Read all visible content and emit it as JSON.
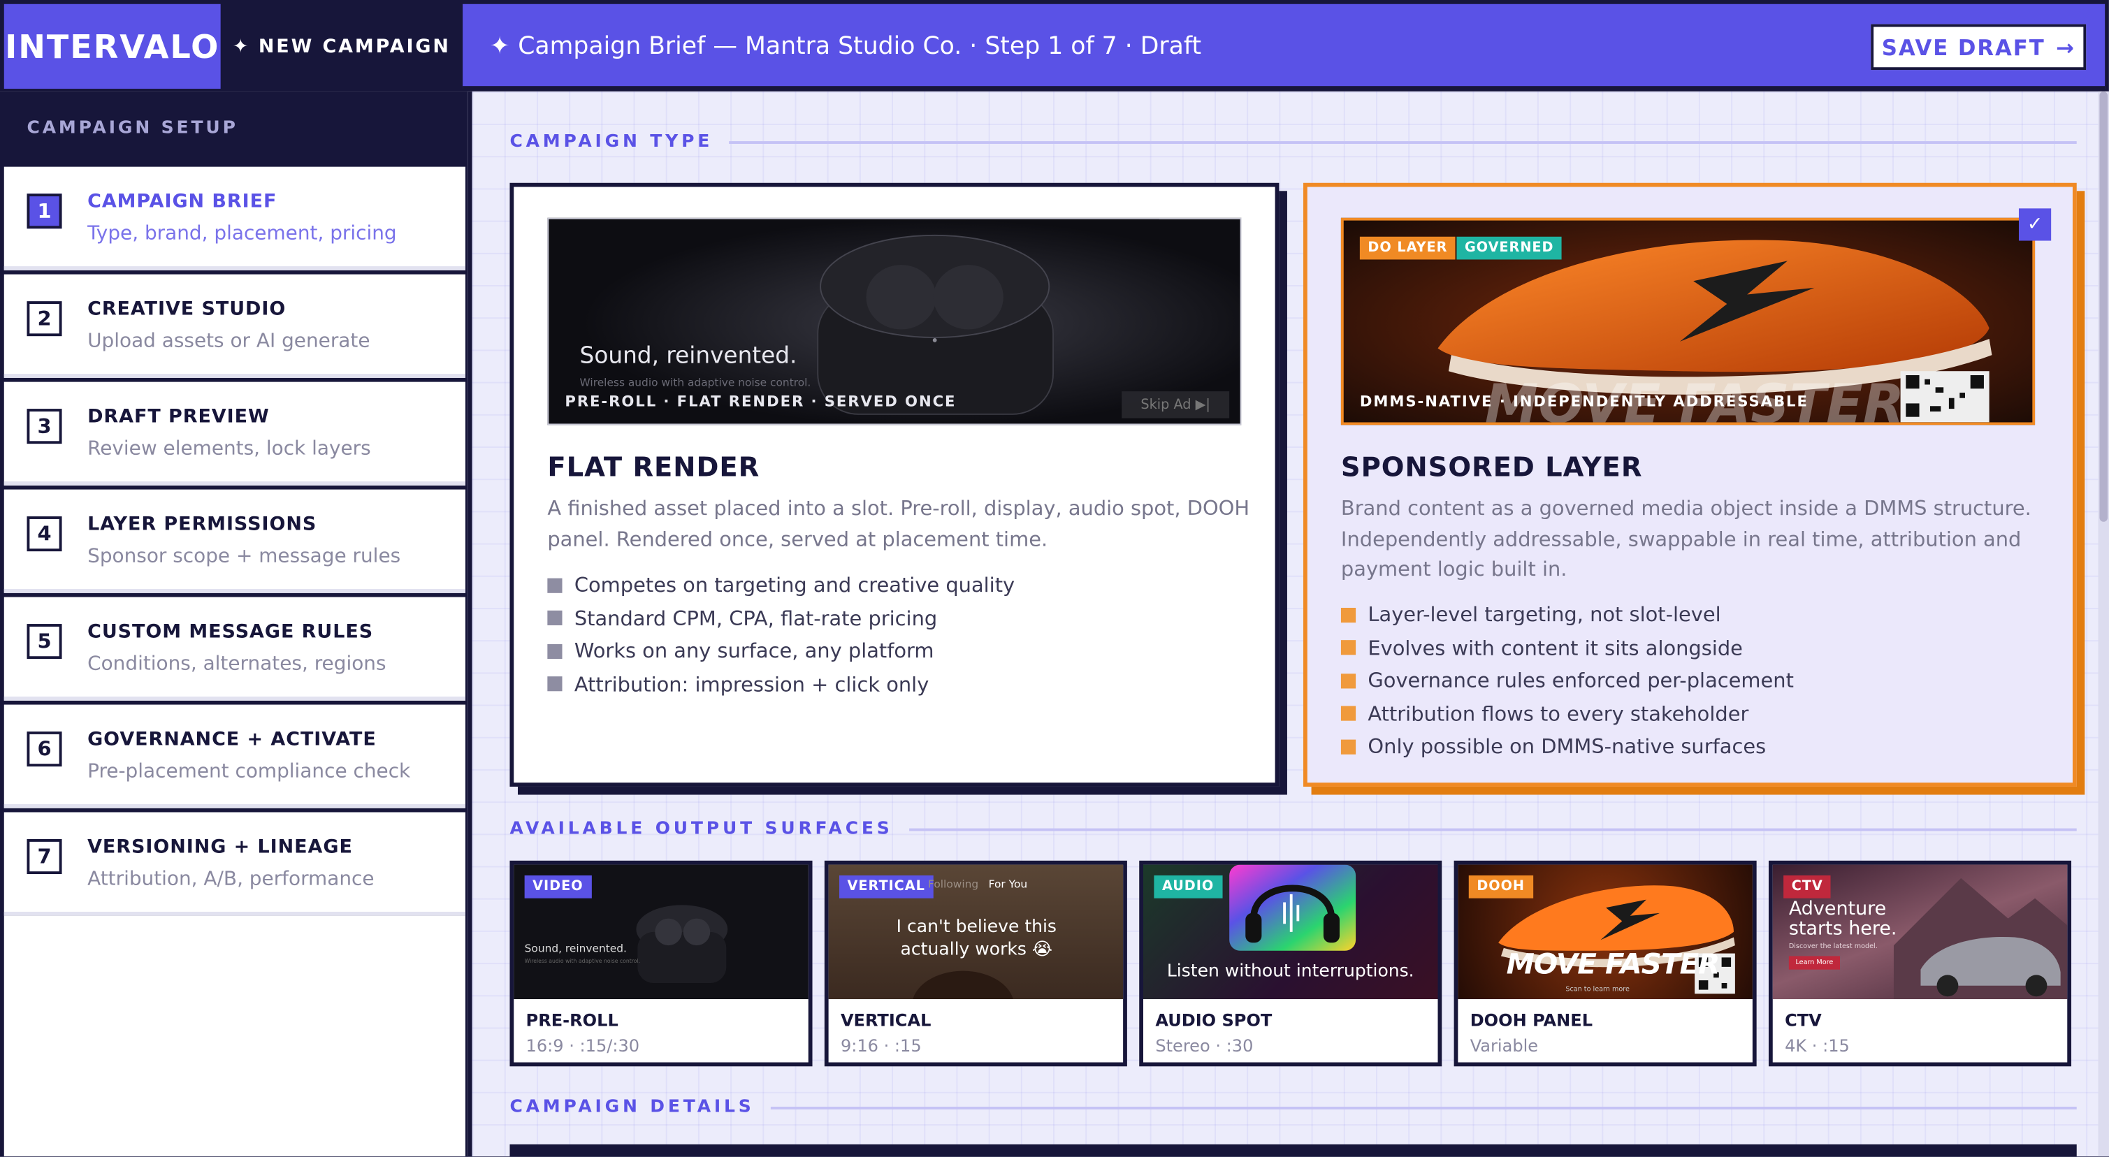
{
  "app": {
    "brand": "INTERVALO",
    "new_campaign_label": "NEW CAMPAIGN",
    "breadcrumb": "Campaign Brief — Mantra Studio Co. · Step 1 of 7 · Draft",
    "save_draft_label": "SAVE DRAFT",
    "colors": {
      "primary": "#5a52e6",
      "navy": "#17163a",
      "accent_orange": "#f08a24",
      "teal": "#1fb5a3"
    }
  },
  "sidebar": {
    "title": "CAMPAIGN SETUP",
    "steps": [
      {
        "num": "1",
        "title": "CAMPAIGN BRIEF",
        "sub": "Type, brand, placement, pricing",
        "active": true
      },
      {
        "num": "2",
        "title": "CREATIVE STUDIO",
        "sub": "Upload assets or AI generate",
        "active": false
      },
      {
        "num": "3",
        "title": "DRAFT PREVIEW",
        "sub": "Review elements, lock layers",
        "active": false
      },
      {
        "num": "4",
        "title": "LAYER PERMISSIONS",
        "sub": "Sponsor scope + message rules",
        "active": false
      },
      {
        "num": "5",
        "title": "CUSTOM MESSAGE RULES",
        "sub": "Conditions, alternates, regions",
        "active": false
      },
      {
        "num": "6",
        "title": "GOVERNANCE + ACTIVATE",
        "sub": "Pre-placement compliance check",
        "active": false
      },
      {
        "num": "7",
        "title": "VERSIONING + LINEAGE",
        "sub": "Attribution, A/B, performance",
        "active": false
      }
    ]
  },
  "campaign_type": {
    "heading": "CAMPAIGN TYPE",
    "options": [
      {
        "title": "FLAT RENDER",
        "selected": false,
        "preview": {
          "headline": "Sound, reinvented.",
          "tagline": "Wireless audio with adaptive noise control.",
          "caption": "PRE-ROLL · FLAT RENDER · SERVED ONCE",
          "skip_label": "Skip Ad ▶|"
        },
        "description": "A finished asset placed into a slot. Pre-roll, display, audio spot, DOOH panel. Rendered once, served at placement time.",
        "bullets": [
          "Competes on targeting and creative quality",
          "Standard CPM, CPA, flat-rate pricing",
          "Works on any surface, any platform",
          "Attribution: impression + click only"
        ]
      },
      {
        "title": "SPONSORED LAYER",
        "selected": true,
        "preview": {
          "badges": [
            "DO LAYER",
            "GOVERNED"
          ],
          "caption": "DMMS-NATIVE · INDEPENDENTLY ADDRESSABLE",
          "bg_text": "MOVE FASTER"
        },
        "description": "Brand content as a governed media object inside a DMMS structure. Independently addressable, swappable in real time, attribution and payment logic built in.",
        "bullets": [
          "Layer-level targeting, not slot-level",
          "Evolves with content it sits alongside",
          "Governance rules enforced per-placement",
          "Attribution flows to every stakeholder",
          "Only possible on DMMS-native surfaces"
        ]
      }
    ]
  },
  "surfaces": {
    "heading": "AVAILABLE OUTPUT SURFACES",
    "items": [
      {
        "badge": "VIDEO",
        "badge_color": "#5a52e6",
        "title": "PRE-ROLL",
        "sub": "16:9 · :15/:30",
        "thumb_text": "Sound, reinvented.",
        "thumb_small": "Wireless audio with adaptive noise control."
      },
      {
        "badge": "VERTICAL",
        "badge_color": "#5a52e6",
        "title": "VERTICAL",
        "sub": "9:16 · :15",
        "thumb_text": "I can't believe this actually works 😭",
        "tab_following": "Following",
        "tab_foryou": "For You"
      },
      {
        "badge": "AUDIO",
        "badge_color": "#1fb5a3",
        "title": "AUDIO SPOT",
        "sub": "Stereo · :30",
        "thumb_text": "Listen without interruptions."
      },
      {
        "badge": "DOOH",
        "badge_color": "#f08a24",
        "title": "DOOH PANEL",
        "sub": "Variable",
        "thumb_text": "MOVE FASTER",
        "thumb_small": "Scan to learn more"
      },
      {
        "badge": "CTV",
        "badge_color": "#c0283c",
        "title": "CTV",
        "sub": "4K · :15",
        "thumb_text": "Adventure starts here.",
        "thumb_small": "Discover the latest model.",
        "thumb_btn": "Learn More"
      }
    ]
  },
  "campaign_details": {
    "heading": "CAMPAIGN DETAILS"
  }
}
